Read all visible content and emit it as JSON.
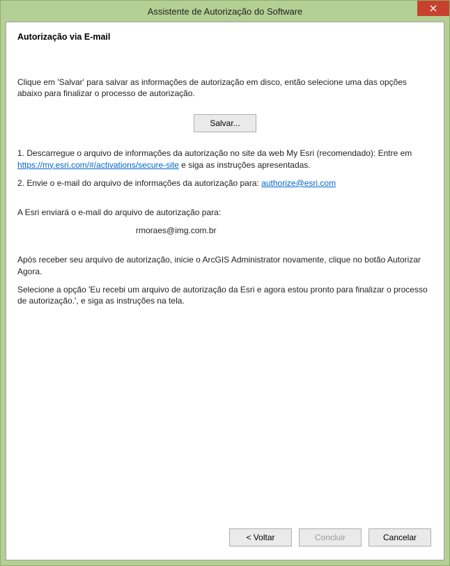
{
  "window": {
    "title": "Assistente de Autorização do Software"
  },
  "header": {
    "heading": "Autorização via E-mail"
  },
  "content": {
    "intro": "Clique em 'Salvar' para salvar as informações de autorização em disco, então selecione uma das opções abaixo para finalizar o processo de autorização.",
    "save_button": "Salvar...",
    "step1_prefix": "1.  Descarregue o arquivo de informações da autorização no site da web My Esri (recomendado):  Entre em ",
    "step1_link": "https://my.esri.com/#/activations/secure-site",
    "step1_suffix": " e siga as instruções apresentadas.",
    "step2_prefix": "2.  Envie o e-mail do arquivo de informações da autorização para: ",
    "step2_link": "authorize@esri.com",
    "send_notice": "A Esri enviará o e-mail do arquivo de autorização para:",
    "target_email": "rmoraes@img.com.br",
    "after1": "Após receber seu arquivo de autorização, inicie o ArcGIS Administrator novamente, clique no botão Autorizar Agora.",
    "after2": "Selecione a opção 'Eu recebi um arquivo de autorização da Esri e agora estou pronto para finalizar o processo de autorização.', e siga as instruções na tela."
  },
  "footer": {
    "back": "< Voltar",
    "finish": "Concluir",
    "cancel": "Cancelar"
  }
}
